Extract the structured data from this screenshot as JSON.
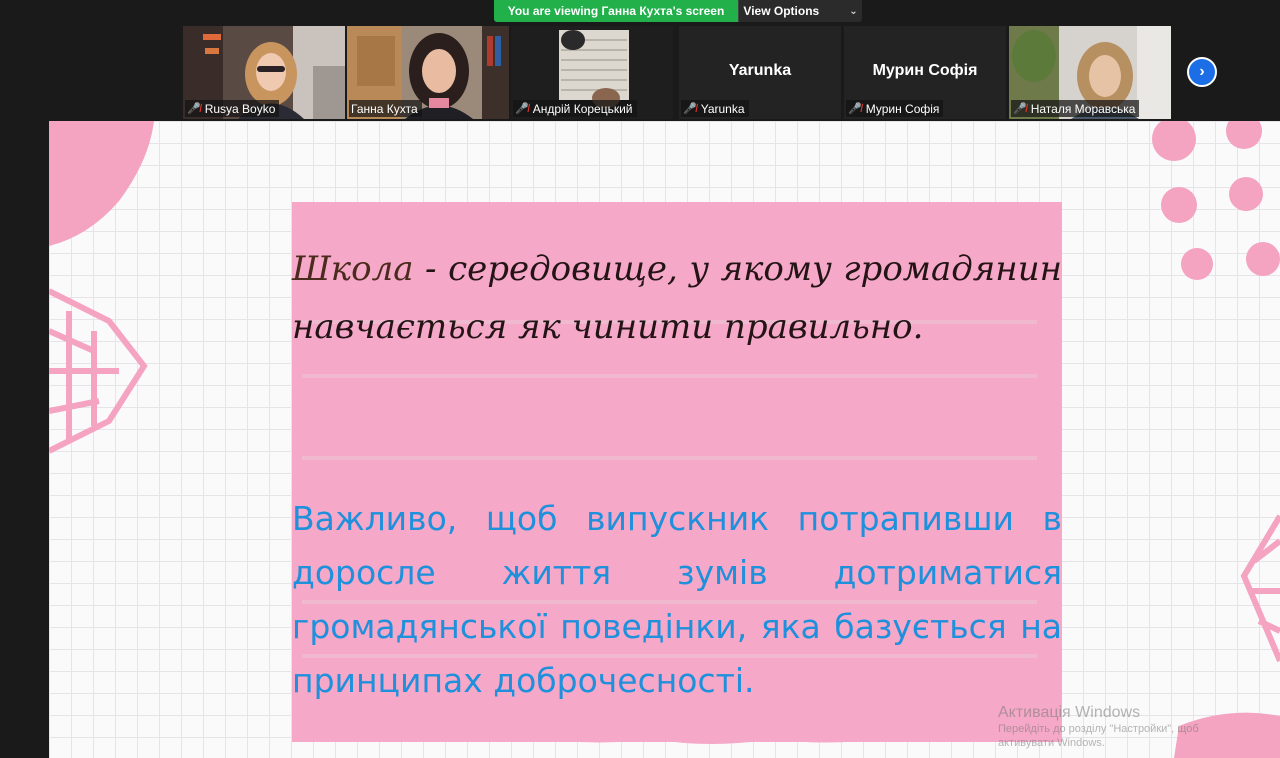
{
  "banner": {
    "viewing_text": "You are viewing Ганна Кухта's screen",
    "view_options_label": "View Options"
  },
  "participants": [
    {
      "name": "Rusya Boyko",
      "video": true
    },
    {
      "name": "Ганна Кухта",
      "video": true,
      "active": true
    },
    {
      "name": "Андрій Корецький",
      "video": true
    },
    {
      "name": "Yarunka",
      "video": false,
      "display_name": "Yarunka"
    },
    {
      "name": "Мурин Софія",
      "video": false,
      "display_name": "Мурин Софія"
    },
    {
      "name": "Наталя Моравська",
      "video": true
    }
  ],
  "icons": {
    "muted_mic": "muted-mic-icon",
    "next_page": "chevron-right-icon"
  },
  "slide": {
    "paragraph1_first": "Школа",
    "paragraph1_rest": " - середовище, у якому громадянин навчається як чинити правильно.",
    "paragraph2": "Важливо, щоб випускник потрапивши в доросле життя зумів дотриматися громадянської поведінки, яка базується на принципах доброчесності."
  },
  "watermark": {
    "title": "Активація Windows",
    "line1": "Перейдіть до розділу \"Настройки\", щоб",
    "line2": "активувати Windows."
  },
  "colors": {
    "banner_green": "#22b04b",
    "card_pink": "#f5a8c7",
    "accent_blue": "#1e90dc"
  }
}
